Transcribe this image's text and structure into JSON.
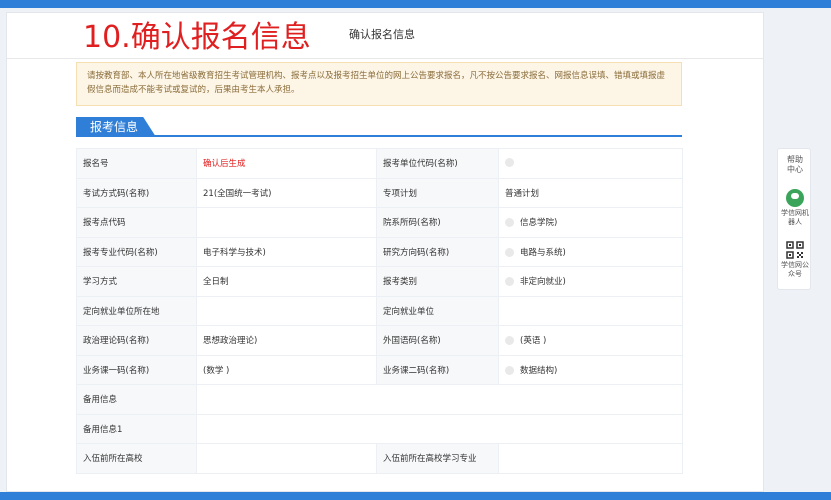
{
  "page": {
    "big_title": "10.确认报名信息",
    "sub_title": "确认报名信息"
  },
  "notice": {
    "text": "请按教育部、本人所在地省级教育招生考试管理机构、报考点以及报考招生单位的网上公告要求报名，凡不按公告要求报名、网报信息误填、错填或填报虚假信息而造成不能考试或复试的，后果由考生本人承担。"
  },
  "section": {
    "title": "报考信息"
  },
  "rows": [
    {
      "l1": "报名号",
      "v1": "确认后生成",
      "v1_red": true,
      "v1_dot": false,
      "l2": "报考单位代码(名称)",
      "v2": "",
      "v2_dot": true
    },
    {
      "l1": "考试方式码(名称)",
      "v1": "21(全国统一考试)",
      "v1_red": false,
      "v1_dot": false,
      "l2": "专项计划",
      "v2": "普通计划",
      "v2_dot": false
    },
    {
      "l1": "报考点代码",
      "v1": "",
      "v1_red": false,
      "v1_dot": false,
      "l2": "院系所码(名称)",
      "v2": "信息学院)",
      "v2_dot": true
    },
    {
      "l1": "报考专业代码(名称)",
      "v1": "电子科学与技术)",
      "v1_red": false,
      "v1_dot": false,
      "l2": "研究方向码(名称)",
      "v2": "电路与系统)",
      "v2_dot": true
    },
    {
      "l1": "学习方式",
      "v1": "全日制",
      "v1_red": false,
      "v1_dot": false,
      "l2": "报考类别",
      "v2": "非定向就业)",
      "v2_dot": true
    },
    {
      "l1": "定向就业单位所在地",
      "v1": "",
      "v1_red": false,
      "v1_dot": false,
      "l2": "定向就业单位",
      "v2": "",
      "v2_dot": false
    },
    {
      "l1": "政治理论码(名称)",
      "v1": "思想政治理论)",
      "v1_red": false,
      "v1_dot": false,
      "l2": "外国语码(名称)",
      "v2": "(英语 )",
      "v2_dot": true
    },
    {
      "l1": "业务课一码(名称)",
      "v1": "(数学 )",
      "v1_red": false,
      "v1_dot": false,
      "l2": "业务课二码(名称)",
      "v2": "数据结构)",
      "v2_dot": true
    },
    {
      "l1": "备用信息",
      "v1": "",
      "full": true
    },
    {
      "l1": "备用信息1",
      "v1": "",
      "full": true
    },
    {
      "l1": "入伍前所在高校",
      "v1": "",
      "v1_red": false,
      "v1_dot": false,
      "l2": "入伍前所在高校学习专业",
      "v2": "",
      "v2_dot": false
    }
  ],
  "sidebar": {
    "help": "帮助中心",
    "robot": "学信网机器人",
    "wechat": "学信网公众号"
  },
  "colors": {
    "accent": "#2f7fd8",
    "title_red": "#e02020",
    "notice_bg": "#fdf5e6"
  }
}
